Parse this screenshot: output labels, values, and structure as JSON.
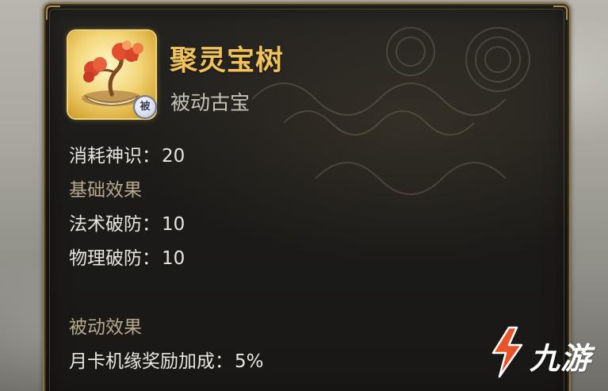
{
  "item": {
    "name": "聚灵宝树",
    "type": "被动古宝",
    "badge": "被",
    "icon": "bonsai-tree-icon"
  },
  "cost": {
    "label": "消耗神识：",
    "value": "20"
  },
  "basic_effects": {
    "title": "基础效果",
    "stats": [
      {
        "label": "法术破防：",
        "value": "10"
      },
      {
        "label": "物理破防：",
        "value": "10"
      }
    ]
  },
  "passive_effects": {
    "title": "被动效果",
    "stats": [
      {
        "label": "月卡机缘奖励加成：",
        "value": "5%"
      }
    ]
  },
  "watermark": {
    "text": "九游",
    "logo": "jiuyou-logo-icon",
    "color": "#e8542a"
  },
  "colors": {
    "title": "#f1c25a",
    "section": "#b8a98c",
    "text": "#e9e6df",
    "border": "#8a7446"
  }
}
